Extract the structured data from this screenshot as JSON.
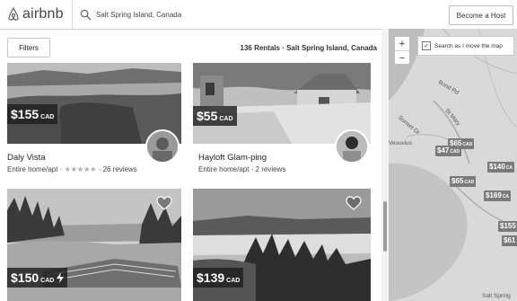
{
  "header": {
    "logo_text": "airbnb",
    "search_value": "Salt Spring Island, Canada",
    "become_host": "Become a Host"
  },
  "toolbar": {
    "filters_label": "Filters",
    "rental_count": "136 Rentals · Salt Spring Island, Canada"
  },
  "listings": [
    {
      "price": "$155",
      "currency": "CAD",
      "title": "Daly Vista",
      "type": "Entire home/apt",
      "stars": "★★★★★",
      "reviews": "26 reviews",
      "dot": " · "
    },
    {
      "price": "$55",
      "currency": "CAD",
      "title": "Hayloft Glam-ping",
      "type": "Entire home/apt",
      "reviews": "2 reviews",
      "dot": " · "
    },
    {
      "price": "$150",
      "currency": "CAD"
    },
    {
      "price": "$139",
      "currency": "CAD"
    }
  ],
  "map": {
    "zoom_in": "+",
    "zoom_out": "−",
    "search_as_move": "Search as I move the map",
    "labels": [
      "Vesuvius",
      "St Mary",
      "Bond Rd",
      "Sunset Dr",
      "Salt Spring"
    ],
    "pins": [
      {
        "amt": "$65",
        "cur": "CAD"
      },
      {
        "amt": "$47",
        "cur": "CAD"
      },
      {
        "amt": "$140",
        "cur": "CA"
      },
      {
        "amt": "$65",
        "cur": "CAD"
      },
      {
        "amt": "$169",
        "cur": "CA"
      },
      {
        "amt": "$155",
        "cur": ""
      },
      {
        "amt": "$61",
        "cur": ""
      }
    ]
  },
  "colors": {
    "accent": "#333333",
    "price_bg": "#1e1e1e",
    "pin_bg": "#7a7a7a"
  }
}
